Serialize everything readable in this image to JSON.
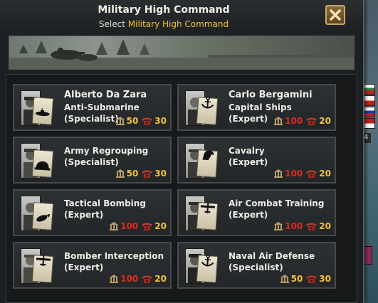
{
  "window": {
    "title": "Military High Command",
    "subtitle_prefix": "Select",
    "subtitle_highlight": "Military High Command"
  },
  "colors": {
    "highlight": "#f1c232",
    "cost_affordable": "#f1c232",
    "cost_expensive": "#e02a1a"
  },
  "map_edge": {
    "badge_number": "4"
  },
  "advisors": [
    {
      "name": "Alberto Da Zara",
      "trait": "Anti-Submarine",
      "level": "(Specialist)",
      "pp": "50",
      "cp": "30",
      "pp_color": "#f1c232",
      "icon": "submarine-icon"
    },
    {
      "name": "Carlo Bergamini",
      "trait": "Capital Ships",
      "level": "(Expert)",
      "pp": "100",
      "cp": "20",
      "pp_color": "#e02a1a",
      "icon": "anchor-icon"
    },
    {
      "name": "",
      "trait": "Army Regrouping",
      "level": "(Specialist)",
      "pp": "50",
      "cp": "30",
      "pp_color": "#f1c232",
      "icon": "helmet-icon"
    },
    {
      "name": "",
      "trait": "Cavalry",
      "level": "(Expert)",
      "pp": "100",
      "cp": "20",
      "pp_color": "#e02a1a",
      "icon": "horse-icon"
    },
    {
      "name": "",
      "trait": "Tactical Bombing",
      "level": "(Expert)",
      "pp": "100",
      "cp": "20",
      "pp_color": "#e02a1a",
      "icon": "bomb-icon"
    },
    {
      "name": "",
      "trait": "Air Combat Training",
      "level": "(Expert)",
      "pp": "100",
      "cp": "20",
      "pp_color": "#e02a1a",
      "icon": "fighter-plane-icon"
    },
    {
      "name": "",
      "trait": "Bomber Interception",
      "level": "(Expert)",
      "pp": "100",
      "cp": "20",
      "pp_color": "#e02a1a",
      "icon": "fighter-plane-icon"
    },
    {
      "name": "",
      "trait": "Naval Air Defense",
      "level": "(Specialist)",
      "pp": "50",
      "cp": "30",
      "pp_color": "#f1c232",
      "icon": "anchor-icon"
    }
  ]
}
